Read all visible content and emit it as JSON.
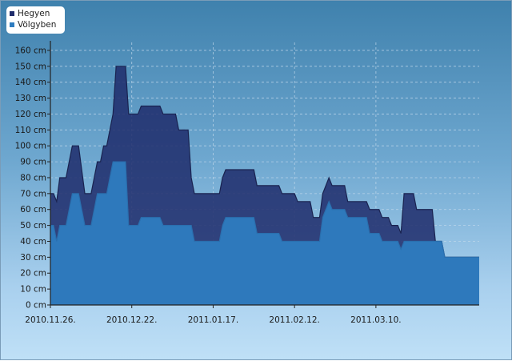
{
  "chart_data": {
    "type": "area",
    "title": "",
    "xlabel": "",
    "ylabel": "",
    "y_unit": "cm",
    "ylim": [
      0,
      165
    ],
    "y_ticks": [
      0,
      10,
      20,
      30,
      40,
      50,
      60,
      70,
      80,
      90,
      100,
      110,
      120,
      130,
      140,
      150,
      160
    ],
    "x_range": [
      "2010-11-26",
      "2011-04-12"
    ],
    "x_ticks": [
      "2010.11.26.",
      "2010.12.22.",
      "2011.01.17.",
      "2011.02.12.",
      "2011.03.10."
    ],
    "grid": true,
    "legend": "top-left",
    "series": [
      {
        "name": "Hegyen",
        "color": "#1f2c6b",
        "points": [
          [
            "2010-11-26",
            70
          ],
          [
            "2010-11-27",
            70
          ],
          [
            "2010-11-28",
            65
          ],
          [
            "2010-11-29",
            80
          ],
          [
            "2010-12-01",
            80
          ],
          [
            "2010-12-03",
            100
          ],
          [
            "2010-12-05",
            100
          ],
          [
            "2010-12-07",
            70
          ],
          [
            "2010-12-09",
            70
          ],
          [
            "2010-12-11",
            90
          ],
          [
            "2010-12-12",
            90
          ],
          [
            "2010-12-13",
            100
          ],
          [
            "2010-12-14",
            100
          ],
          [
            "2010-12-16",
            120
          ],
          [
            "2010-12-17",
            150
          ],
          [
            "2010-12-20",
            150
          ],
          [
            "2010-12-21",
            120
          ],
          [
            "2010-12-24",
            120
          ],
          [
            "2010-12-25",
            125
          ],
          [
            "2010-12-31",
            125
          ],
          [
            "2011-01-01",
            120
          ],
          [
            "2011-01-05",
            120
          ],
          [
            "2011-01-06",
            110
          ],
          [
            "2011-01-09",
            110
          ],
          [
            "2011-01-10",
            80
          ],
          [
            "2011-01-11",
            70
          ],
          [
            "2011-01-19",
            70
          ],
          [
            "2011-01-20",
            80
          ],
          [
            "2011-01-21",
            85
          ],
          [
            "2011-01-30",
            85
          ],
          [
            "2011-01-31",
            75
          ],
          [
            "2011-02-07",
            75
          ],
          [
            "2011-02-08",
            70
          ],
          [
            "2011-02-12",
            70
          ],
          [
            "2011-02-13",
            65
          ],
          [
            "2011-02-17",
            65
          ],
          [
            "2011-02-18",
            55
          ],
          [
            "2011-02-20",
            55
          ],
          [
            "2011-02-21",
            70
          ],
          [
            "2011-02-23",
            80
          ],
          [
            "2011-02-24",
            75
          ],
          [
            "2011-02-28",
            75
          ],
          [
            "2011-03-01",
            65
          ],
          [
            "2011-03-07",
            65
          ],
          [
            "2011-03-08",
            60
          ],
          [
            "2011-03-11",
            60
          ],
          [
            "2011-03-12",
            55
          ],
          [
            "2011-03-14",
            55
          ],
          [
            "2011-03-15",
            50
          ],
          [
            "2011-03-17",
            50
          ],
          [
            "2011-03-18",
            45
          ],
          [
            "2011-03-19",
            70
          ],
          [
            "2011-03-22",
            70
          ],
          [
            "2011-03-23",
            60
          ],
          [
            "2011-03-28",
            60
          ],
          [
            "2011-03-29",
            40
          ],
          [
            "2011-03-31",
            40
          ],
          [
            "2011-04-01",
            30
          ],
          [
            "2011-04-12",
            30
          ]
        ]
      },
      {
        "name": "Völgyben",
        "color": "#2e7cc0",
        "points": [
          [
            "2010-11-26",
            50
          ],
          [
            "2010-11-27",
            50
          ],
          [
            "2010-11-28",
            40
          ],
          [
            "2010-11-29",
            50
          ],
          [
            "2010-12-01",
            50
          ],
          [
            "2010-12-03",
            70
          ],
          [
            "2010-12-05",
            70
          ],
          [
            "2010-12-07",
            50
          ],
          [
            "2010-12-09",
            50
          ],
          [
            "2010-12-11",
            70
          ],
          [
            "2010-12-14",
            70
          ],
          [
            "2010-12-16",
            90
          ],
          [
            "2010-12-20",
            90
          ],
          [
            "2010-12-21",
            50
          ],
          [
            "2010-12-24",
            50
          ],
          [
            "2010-12-25",
            55
          ],
          [
            "2010-12-31",
            55
          ],
          [
            "2011-01-01",
            50
          ],
          [
            "2011-01-10",
            50
          ],
          [
            "2011-01-11",
            40
          ],
          [
            "2011-01-19",
            40
          ],
          [
            "2011-01-20",
            50
          ],
          [
            "2011-01-21",
            55
          ],
          [
            "2011-01-30",
            55
          ],
          [
            "2011-01-31",
            45
          ],
          [
            "2011-02-07",
            45
          ],
          [
            "2011-02-08",
            40
          ],
          [
            "2011-02-20",
            40
          ],
          [
            "2011-02-21",
            55
          ],
          [
            "2011-02-23",
            65
          ],
          [
            "2011-02-24",
            60
          ],
          [
            "2011-02-28",
            60
          ],
          [
            "2011-03-01",
            55
          ],
          [
            "2011-03-07",
            55
          ],
          [
            "2011-03-08",
            45
          ],
          [
            "2011-03-11",
            45
          ],
          [
            "2011-03-12",
            40
          ],
          [
            "2011-03-17",
            40
          ],
          [
            "2011-03-18",
            35
          ],
          [
            "2011-03-19",
            40
          ],
          [
            "2011-03-31",
            40
          ],
          [
            "2011-04-01",
            30
          ],
          [
            "2011-04-12",
            30
          ]
        ]
      }
    ]
  }
}
